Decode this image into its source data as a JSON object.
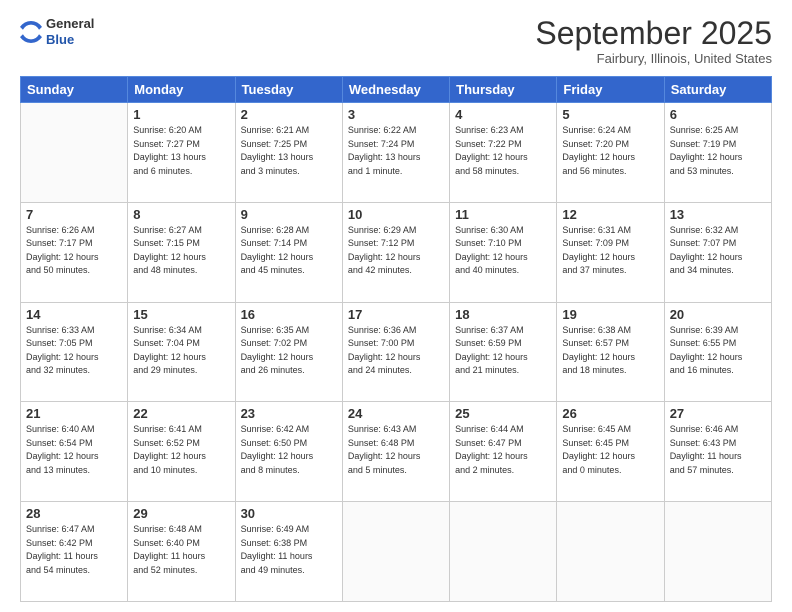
{
  "header": {
    "logo": {
      "line1": "General",
      "line2": "Blue"
    },
    "month": "September 2025",
    "location": "Fairbury, Illinois, United States"
  },
  "weekdays": [
    "Sunday",
    "Monday",
    "Tuesday",
    "Wednesday",
    "Thursday",
    "Friday",
    "Saturday"
  ],
  "weeks": [
    [
      {
        "day": "",
        "info": ""
      },
      {
        "day": "1",
        "info": "Sunrise: 6:20 AM\nSunset: 7:27 PM\nDaylight: 13 hours\nand 6 minutes."
      },
      {
        "day": "2",
        "info": "Sunrise: 6:21 AM\nSunset: 7:25 PM\nDaylight: 13 hours\nand 3 minutes."
      },
      {
        "day": "3",
        "info": "Sunrise: 6:22 AM\nSunset: 7:24 PM\nDaylight: 13 hours\nand 1 minute."
      },
      {
        "day": "4",
        "info": "Sunrise: 6:23 AM\nSunset: 7:22 PM\nDaylight: 12 hours\nand 58 minutes."
      },
      {
        "day": "5",
        "info": "Sunrise: 6:24 AM\nSunset: 7:20 PM\nDaylight: 12 hours\nand 56 minutes."
      },
      {
        "day": "6",
        "info": "Sunrise: 6:25 AM\nSunset: 7:19 PM\nDaylight: 12 hours\nand 53 minutes."
      }
    ],
    [
      {
        "day": "7",
        "info": "Sunrise: 6:26 AM\nSunset: 7:17 PM\nDaylight: 12 hours\nand 50 minutes."
      },
      {
        "day": "8",
        "info": "Sunrise: 6:27 AM\nSunset: 7:15 PM\nDaylight: 12 hours\nand 48 minutes."
      },
      {
        "day": "9",
        "info": "Sunrise: 6:28 AM\nSunset: 7:14 PM\nDaylight: 12 hours\nand 45 minutes."
      },
      {
        "day": "10",
        "info": "Sunrise: 6:29 AM\nSunset: 7:12 PM\nDaylight: 12 hours\nand 42 minutes."
      },
      {
        "day": "11",
        "info": "Sunrise: 6:30 AM\nSunset: 7:10 PM\nDaylight: 12 hours\nand 40 minutes."
      },
      {
        "day": "12",
        "info": "Sunrise: 6:31 AM\nSunset: 7:09 PM\nDaylight: 12 hours\nand 37 minutes."
      },
      {
        "day": "13",
        "info": "Sunrise: 6:32 AM\nSunset: 7:07 PM\nDaylight: 12 hours\nand 34 minutes."
      }
    ],
    [
      {
        "day": "14",
        "info": "Sunrise: 6:33 AM\nSunset: 7:05 PM\nDaylight: 12 hours\nand 32 minutes."
      },
      {
        "day": "15",
        "info": "Sunrise: 6:34 AM\nSunset: 7:04 PM\nDaylight: 12 hours\nand 29 minutes."
      },
      {
        "day": "16",
        "info": "Sunrise: 6:35 AM\nSunset: 7:02 PM\nDaylight: 12 hours\nand 26 minutes."
      },
      {
        "day": "17",
        "info": "Sunrise: 6:36 AM\nSunset: 7:00 PM\nDaylight: 12 hours\nand 24 minutes."
      },
      {
        "day": "18",
        "info": "Sunrise: 6:37 AM\nSunset: 6:59 PM\nDaylight: 12 hours\nand 21 minutes."
      },
      {
        "day": "19",
        "info": "Sunrise: 6:38 AM\nSunset: 6:57 PM\nDaylight: 12 hours\nand 18 minutes."
      },
      {
        "day": "20",
        "info": "Sunrise: 6:39 AM\nSunset: 6:55 PM\nDaylight: 12 hours\nand 16 minutes."
      }
    ],
    [
      {
        "day": "21",
        "info": "Sunrise: 6:40 AM\nSunset: 6:54 PM\nDaylight: 12 hours\nand 13 minutes."
      },
      {
        "day": "22",
        "info": "Sunrise: 6:41 AM\nSunset: 6:52 PM\nDaylight: 12 hours\nand 10 minutes."
      },
      {
        "day": "23",
        "info": "Sunrise: 6:42 AM\nSunset: 6:50 PM\nDaylight: 12 hours\nand 8 minutes."
      },
      {
        "day": "24",
        "info": "Sunrise: 6:43 AM\nSunset: 6:48 PM\nDaylight: 12 hours\nand 5 minutes."
      },
      {
        "day": "25",
        "info": "Sunrise: 6:44 AM\nSunset: 6:47 PM\nDaylight: 12 hours\nand 2 minutes."
      },
      {
        "day": "26",
        "info": "Sunrise: 6:45 AM\nSunset: 6:45 PM\nDaylight: 12 hours\nand 0 minutes."
      },
      {
        "day": "27",
        "info": "Sunrise: 6:46 AM\nSunset: 6:43 PM\nDaylight: 11 hours\nand 57 minutes."
      }
    ],
    [
      {
        "day": "28",
        "info": "Sunrise: 6:47 AM\nSunset: 6:42 PM\nDaylight: 11 hours\nand 54 minutes."
      },
      {
        "day": "29",
        "info": "Sunrise: 6:48 AM\nSunset: 6:40 PM\nDaylight: 11 hours\nand 52 minutes."
      },
      {
        "day": "30",
        "info": "Sunrise: 6:49 AM\nSunset: 6:38 PM\nDaylight: 11 hours\nand 49 minutes."
      },
      {
        "day": "",
        "info": ""
      },
      {
        "day": "",
        "info": ""
      },
      {
        "day": "",
        "info": ""
      },
      {
        "day": "",
        "info": ""
      }
    ]
  ]
}
